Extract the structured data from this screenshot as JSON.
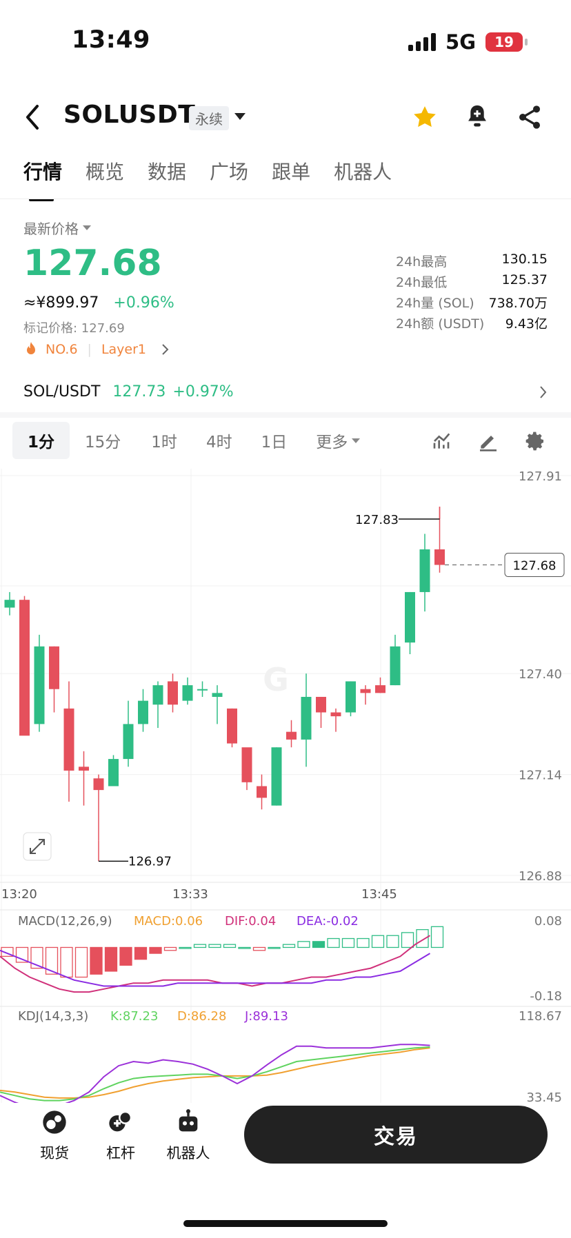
{
  "status_bar": {
    "time": "13:49",
    "network": "5G",
    "battery": "19"
  },
  "header": {
    "symbol": "SOLUSDT",
    "contract_tag": "永续",
    "icons": [
      "back-icon",
      "star-icon",
      "bell-plus-icon",
      "share-icon"
    ],
    "star_color": "#f5b800"
  },
  "tabs": [
    {
      "label": "行情",
      "active": true
    },
    {
      "label": "概览"
    },
    {
      "label": "数据"
    },
    {
      "label": "广场"
    },
    {
      "label": "跟单"
    },
    {
      "label": "机器人"
    }
  ],
  "price": {
    "label": "最新价格",
    "last": "127.68",
    "cny": "≈¥899.97",
    "change": "+0.96%",
    "mark_price": "标记价格: 127.69",
    "rank": "NO.6",
    "sector": "Layer1"
  },
  "stats": [
    {
      "k": "24h最高",
      "v": "130.15"
    },
    {
      "k": "24h最低",
      "v": "125.37"
    },
    {
      "k": "24h量 (SOL)",
      "v": "738.70万"
    },
    {
      "k": "24h额 (USDT)",
      "v": "9.43亿"
    }
  ],
  "spot": {
    "pair": "SOL/USDT",
    "price": "127.73",
    "change": "+0.97%"
  },
  "timeframes": {
    "items": [
      "1分",
      "15分",
      "1时",
      "4时",
      "1日"
    ],
    "more": "更多",
    "selected": 0
  },
  "colors": {
    "up": "#2ebd85",
    "down": "#e5505c",
    "accent": "#f0843c",
    "macd": "#f0a030",
    "dif": "#d0307a",
    "dea": "#8a2be2",
    "k": "#5fd35f",
    "d": "#f0a030",
    "j": "#9b30d9"
  },
  "chart_data": {
    "type": "candlestick",
    "y_ticks": [
      "127.91",
      "127.40",
      "127.14",
      "126.88"
    ],
    "x_ticks": [
      "13:20",
      "13:33",
      "13:45"
    ],
    "last_price_label": "127.68",
    "high_marker": "127.83",
    "low_marker": "126.97",
    "ylim": [
      126.88,
      127.91
    ],
    "candles": [
      {
        "o": 127.57,
        "h": 127.61,
        "l": 127.55,
        "c": 127.59
      },
      {
        "o": 127.59,
        "h": 127.6,
        "l": 127.29,
        "c": 127.24
      },
      {
        "o": 127.27,
        "h": 127.5,
        "l": 127.25,
        "c": 127.47
      },
      {
        "o": 127.47,
        "h": 127.47,
        "l": 127.3,
        "c": 127.36
      },
      {
        "o": 127.31,
        "h": 127.38,
        "l": 127.07,
        "c": 127.15
      },
      {
        "o": 127.16,
        "h": 127.2,
        "l": 127.06,
        "c": 127.15
      },
      {
        "o": 127.13,
        "h": 127.14,
        "l": 126.97,
        "c": 127.1
      },
      {
        "o": 127.11,
        "h": 127.19,
        "l": 127.11,
        "c": 127.18
      },
      {
        "o": 127.18,
        "h": 127.33,
        "l": 127.16,
        "c": 127.27
      },
      {
        "o": 127.27,
        "h": 127.36,
        "l": 127.25,
        "c": 127.33
      },
      {
        "o": 127.32,
        "h": 127.38,
        "l": 127.26,
        "c": 127.37
      },
      {
        "o": 127.38,
        "h": 127.4,
        "l": 127.3,
        "c": 127.32
      },
      {
        "o": 127.33,
        "h": 127.39,
        "l": 127.32,
        "c": 127.37
      },
      {
        "o": 127.36,
        "h": 127.38,
        "l": 127.34,
        "c": 127.36
      },
      {
        "o": 127.34,
        "h": 127.37,
        "l": 127.27,
        "c": 127.35
      },
      {
        "o": 127.31,
        "h": 127.31,
        "l": 127.21,
        "c": 127.22
      },
      {
        "o": 127.21,
        "h": 127.2,
        "l": 127.1,
        "c": 127.12
      },
      {
        "o": 127.11,
        "h": 127.14,
        "l": 127.05,
        "c": 127.08
      },
      {
        "o": 127.06,
        "h": 127.21,
        "l": 127.06,
        "c": 127.21
      },
      {
        "o": 127.25,
        "h": 127.28,
        "l": 127.21,
        "c": 127.23
      },
      {
        "o": 127.23,
        "h": 127.4,
        "l": 127.16,
        "c": 127.34
      },
      {
        "o": 127.34,
        "h": 127.34,
        "l": 127.26,
        "c": 127.3
      },
      {
        "o": 127.3,
        "h": 127.31,
        "l": 127.25,
        "c": 127.29
      },
      {
        "o": 127.3,
        "h": 127.38,
        "l": 127.29,
        "c": 127.38
      },
      {
        "o": 127.36,
        "h": 127.37,
        "l": 127.32,
        "c": 127.35
      },
      {
        "o": 127.37,
        "h": 127.39,
        "l": 127.35,
        "c": 127.35
      },
      {
        "o": 127.37,
        "h": 127.5,
        "l": 127.37,
        "c": 127.47
      },
      {
        "o": 127.48,
        "h": 127.61,
        "l": 127.45,
        "c": 127.61
      },
      {
        "o": 127.61,
        "h": 127.76,
        "l": 127.56,
        "c": 127.72
      },
      {
        "o": 127.72,
        "h": 127.83,
        "l": 127.66,
        "c": 127.68
      }
    ],
    "macd": {
      "title": "MACD(12,26,9)",
      "macd_label": "MACD:0.06",
      "dif_label": "DIF:0.04",
      "dea_label": "DEA:-0.02",
      "y_ticks": [
        "0.08",
        "-0.18"
      ],
      "ylim": [
        -0.18,
        0.08
      ],
      "hist": [
        -0.03,
        -0.05,
        -0.07,
        -0.09,
        -0.1,
        -0.1,
        -0.09,
        -0.08,
        -0.06,
        -0.04,
        -0.02,
        -0.01,
        0.0,
        0.01,
        0.01,
        0.01,
        0.0,
        -0.01,
        0.0,
        0.01,
        0.02,
        0.02,
        0.03,
        0.03,
        0.03,
        0.04,
        0.04,
        0.05,
        0.06,
        0.07
      ],
      "dif": [
        -0.03,
        -0.07,
        -0.1,
        -0.12,
        -0.14,
        -0.15,
        -0.15,
        -0.14,
        -0.13,
        -0.12,
        -0.12,
        -0.11,
        -0.11,
        -0.11,
        -0.11,
        -0.12,
        -0.12,
        -0.13,
        -0.12,
        -0.12,
        -0.11,
        -0.1,
        -0.1,
        -0.09,
        -0.08,
        -0.07,
        -0.05,
        -0.03,
        0.01,
        0.04
      ],
      "dea": [
        -0.01,
        -0.03,
        -0.05,
        -0.07,
        -0.09,
        -0.11,
        -0.12,
        -0.13,
        -0.13,
        -0.13,
        -0.13,
        -0.13,
        -0.12,
        -0.12,
        -0.12,
        -0.12,
        -0.12,
        -0.12,
        -0.12,
        -0.12,
        -0.12,
        -0.12,
        -0.11,
        -0.11,
        -0.1,
        -0.1,
        -0.09,
        -0.08,
        -0.05,
        -0.02
      ]
    },
    "kdj": {
      "title": "KDJ(14,3,3)",
      "k_label": "K:87.23",
      "d_label": "D:86.28",
      "j_label": "J:89.13",
      "y_ticks": [
        "118.67",
        "33.45"
      ],
      "ylim": [
        33.45,
        118.67
      ],
      "k": [
        34,
        30,
        26,
        24,
        24,
        26,
        30,
        38,
        45,
        50,
        52,
        53,
        54,
        55,
        55,
        53,
        50,
        53,
        58,
        64,
        70,
        72,
        74,
        76,
        78,
        80,
        82,
        84,
        86,
        87
      ],
      "d": [
        36,
        34,
        31,
        28,
        27,
        27,
        28,
        31,
        35,
        40,
        44,
        47,
        49,
        51,
        52,
        53,
        53,
        53,
        54,
        57,
        61,
        65,
        68,
        71,
        74,
        77,
        79,
        81,
        84,
        86
      ],
      "j": [
        30,
        22,
        16,
        16,
        18,
        24,
        34,
        52,
        65,
        70,
        68,
        72,
        70,
        67,
        61,
        53,
        44,
        53,
        66,
        78,
        88,
        88,
        86,
        86,
        86,
        86,
        88,
        90,
        90,
        89
      ]
    }
  },
  "bottom_nav": [
    {
      "label": "现货",
      "icon": "spot-icon"
    },
    {
      "label": "杠杆",
      "icon": "leverage-icon"
    },
    {
      "label": "机器人",
      "icon": "robot-icon"
    }
  ],
  "trade_button": "交易"
}
